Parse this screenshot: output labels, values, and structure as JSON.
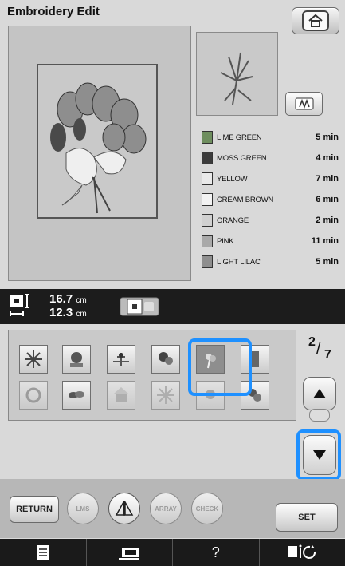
{
  "header": {
    "title": "Embroidery Edit"
  },
  "colors": [
    {
      "name": "LIME GREEN",
      "time": "5 min",
      "hex": "#6e8e5e"
    },
    {
      "name": "MOSS GREEN",
      "time": "4 min",
      "hex": "#3b3b3b"
    },
    {
      "name": "YELLOW",
      "time": "7 min",
      "hex": "#e9e9e9"
    },
    {
      "name": "CREAM BROWN",
      "time": "6 min",
      "hex": "#f2f2f2"
    },
    {
      "name": "ORANGE",
      "time": "2 min",
      "hex": "#d0d0d0"
    },
    {
      "name": "PINK",
      "time": "11 min",
      "hex": "#a9a9a9"
    },
    {
      "name": "LIGHT LILAC",
      "time": "5 min",
      "hex": "#8e8e8e"
    }
  ],
  "size": {
    "height": "16.7",
    "width": "12.3",
    "unit": "cm"
  },
  "pagination": {
    "current": "2",
    "total": "7"
  },
  "buttons": {
    "return": "RETURN",
    "lms": "LMS",
    "array": "ARRAY",
    "check": "CHECK",
    "set": "SET"
  },
  "bottom_bar": {
    "help": "?"
  },
  "accent": "#1e90ff"
}
